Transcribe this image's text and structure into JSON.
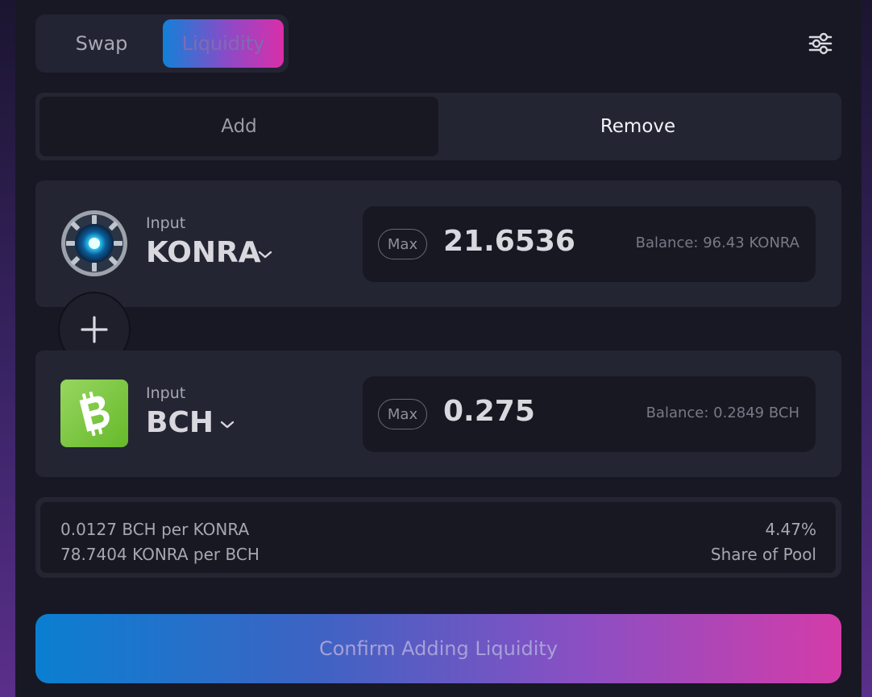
{
  "tabs": {
    "swap": "Swap",
    "liquidity": "Liquidity"
  },
  "mode": {
    "add": "Add",
    "remove": "Remove"
  },
  "tokenA": {
    "input_label": "Input",
    "symbol": "KONRA",
    "max_label": "Max",
    "amount": "21.6536",
    "balance": "Balance: 96.43 KONRA",
    "icon": "konra-token-icon"
  },
  "tokenB": {
    "input_label": "Input",
    "symbol": "BCH",
    "max_label": "Max",
    "amount": "0.275",
    "balance": "Balance: 0.2849 BCH",
    "icon": "bch-token-icon"
  },
  "pool": {
    "rate_a": "0.0127 BCH per KONRA",
    "rate_b": "78.7404 KONRA per BCH",
    "share_value": "4.47%",
    "share_label": "Share of Pool"
  },
  "confirm": {
    "label": "Confirm Adding Liquidity"
  },
  "colors": {
    "gradient_start": "#1281d8",
    "gradient_mid": "#8f49c6",
    "gradient_end": "#da2ea9",
    "bch_green": "#8dc351",
    "panel": "#181824"
  }
}
